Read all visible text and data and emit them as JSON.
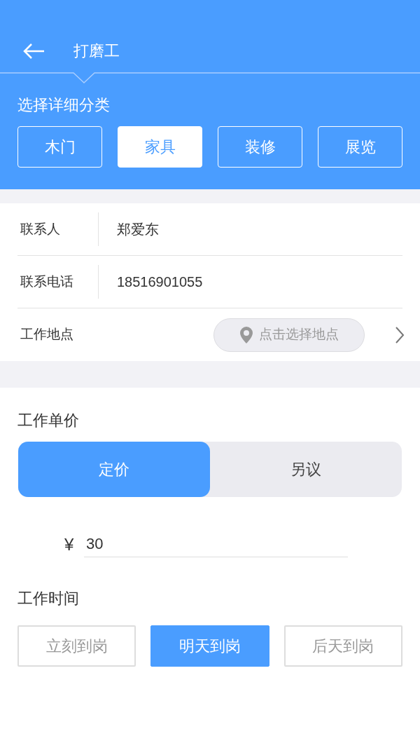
{
  "header": {
    "title": "打磨工"
  },
  "category": {
    "label": "选择详细分类",
    "options": [
      {
        "label": "木门",
        "selected": false
      },
      {
        "label": "家具",
        "selected": true
      },
      {
        "label": "装修",
        "selected": false
      },
      {
        "label": "展览",
        "selected": false
      }
    ]
  },
  "contact": [
    {
      "kind": "text",
      "label": "联系人",
      "value": "郑爱东"
    },
    {
      "kind": "text",
      "label": "联系电话",
      "value": "18516901055"
    },
    {
      "kind": "location",
      "label": "工作地点",
      "placeholder": "点击选择地点"
    }
  ],
  "price": {
    "label": "工作单价",
    "modes": [
      {
        "label": "定价",
        "selected": true
      },
      {
        "label": "另议",
        "selected": false
      }
    ],
    "currency": "¥",
    "value": "30"
  },
  "time": {
    "label": "工作时间",
    "options": [
      {
        "label": "立刻到岗",
        "selected": false
      },
      {
        "label": "明天到岗",
        "selected": true
      },
      {
        "label": "后天到岗",
        "selected": false
      }
    ]
  }
}
